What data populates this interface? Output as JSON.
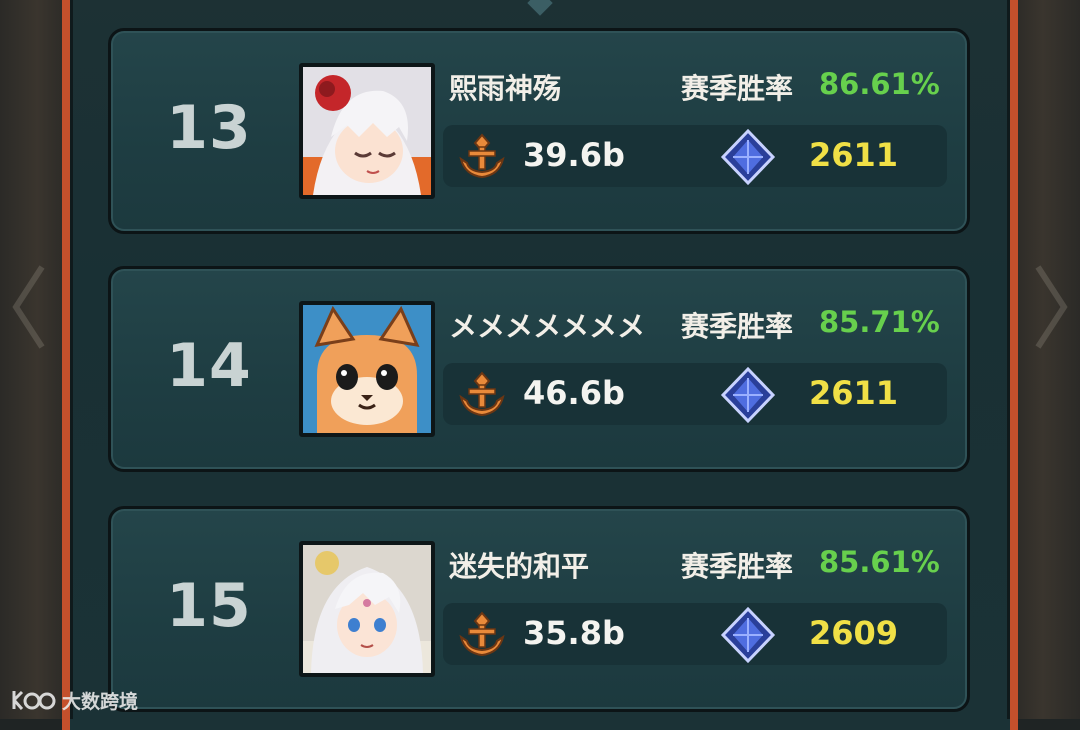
{
  "leaderboard": {
    "rows": [
      {
        "rank": "13",
        "name": "熙雨神殇",
        "winrate_label": "赛季胜率",
        "winrate": "86.61%",
        "power": "39.6b",
        "score": "2611",
        "avatar": "white-hair-girl-avatar"
      },
      {
        "rank": "14",
        "name": "メメメメメメメ",
        "winrate_label": "赛季胜率",
        "winrate": "85.71%",
        "power": "46.6b",
        "score": "2611",
        "avatar": "orange-cat-avatar"
      },
      {
        "rank": "15",
        "name": "迷失的和平",
        "winrate_label": "赛季胜率",
        "winrate": "85.61%",
        "power": "35.8b",
        "score": "2609",
        "avatar": "silver-hair-hero-avatar"
      }
    ]
  },
  "icons": {
    "power": "anchor-emblem-icon",
    "score": "blue-crystal-icon",
    "side_left": "left-arrow-icon",
    "side_right": "right-arrow-icon"
  },
  "colors": {
    "frame": "#c4502c",
    "winrate": "#67d04d",
    "score": "#f0e046",
    "card": "#1e3d42"
  },
  "watermark": {
    "text": "大数跨境"
  }
}
